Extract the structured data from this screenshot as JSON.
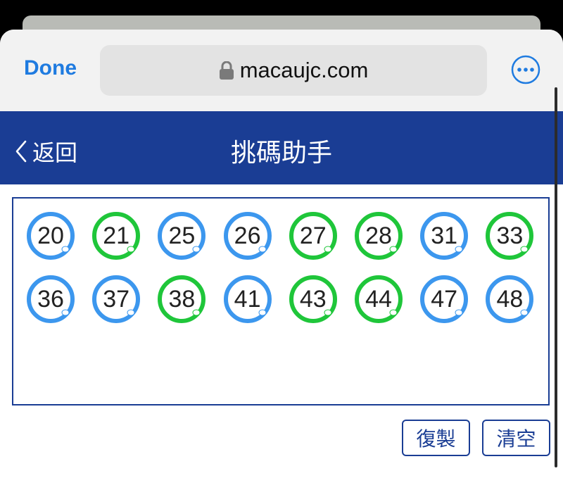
{
  "browser": {
    "done_label": "Done",
    "url": "macaujc.com"
  },
  "header": {
    "back_label": "返回",
    "title": "挑碼助手"
  },
  "colors": {
    "blue_ball": "#3c97ee",
    "green_ball": "#1fc63a",
    "header_bg": "#1a3d94",
    "link_blue": "#1f7be0"
  },
  "balls": [
    {
      "num": "20",
      "color": "blue"
    },
    {
      "num": "21",
      "color": "green"
    },
    {
      "num": "25",
      "color": "blue"
    },
    {
      "num": "26",
      "color": "blue"
    },
    {
      "num": "27",
      "color": "green"
    },
    {
      "num": "28",
      "color": "green"
    },
    {
      "num": "31",
      "color": "blue"
    },
    {
      "num": "33",
      "color": "green"
    },
    {
      "num": "36",
      "color": "blue"
    },
    {
      "num": "37",
      "color": "blue"
    },
    {
      "num": "38",
      "color": "green"
    },
    {
      "num": "41",
      "color": "blue"
    },
    {
      "num": "43",
      "color": "green"
    },
    {
      "num": "44",
      "color": "green"
    },
    {
      "num": "47",
      "color": "blue"
    },
    {
      "num": "48",
      "color": "blue"
    }
  ],
  "actions": {
    "copy_label": "復製",
    "clear_label": "清空"
  }
}
